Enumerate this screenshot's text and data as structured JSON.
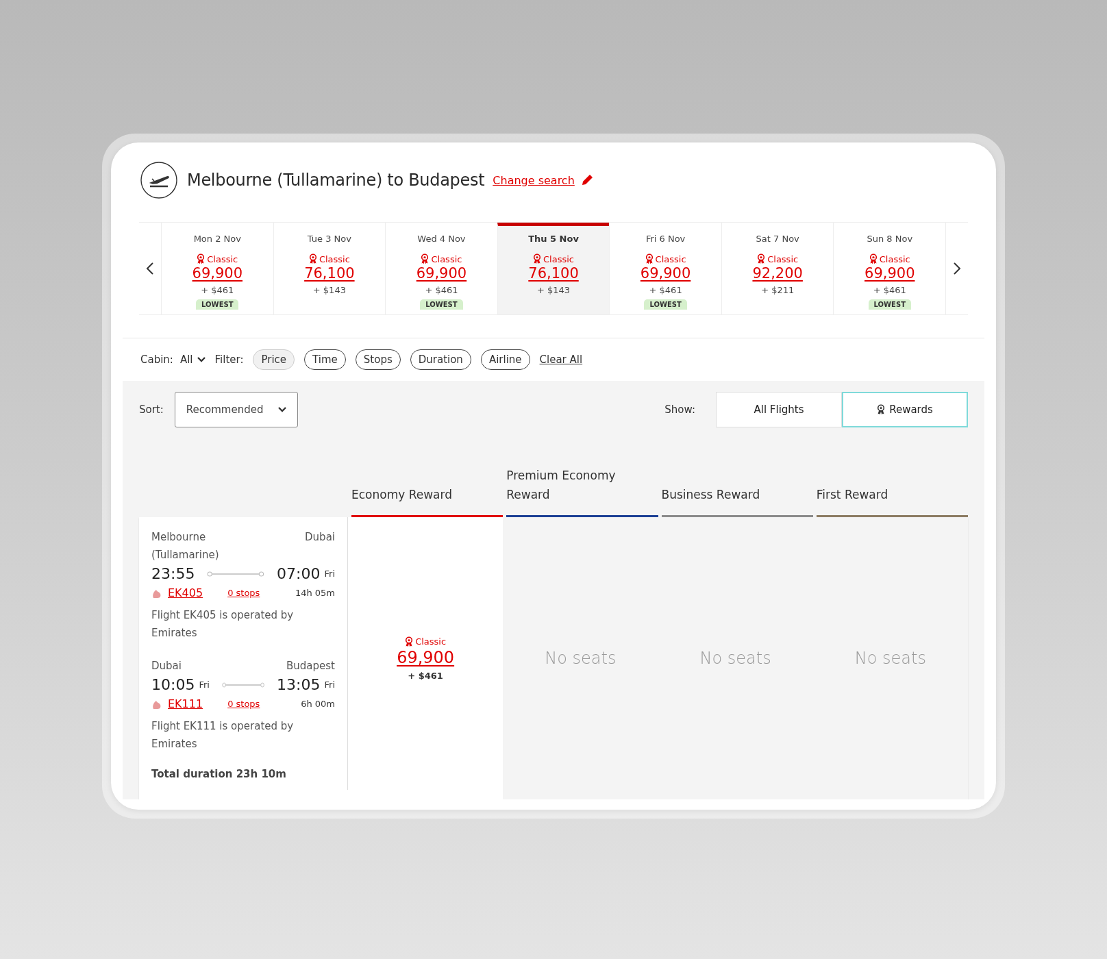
{
  "header": {
    "title": "Melbourne (Tullamarine) to Budapest",
    "change_search": "Change search"
  },
  "dates": [
    {
      "day": "Mon 2 Nov",
      "fare_type": "Classic",
      "points": "69,900",
      "fee": "+ $461",
      "badge": "LOWEST",
      "selected": false
    },
    {
      "day": "Tue 3 Nov",
      "fare_type": "Classic",
      "points": "76,100",
      "fee": "+ $143",
      "selected": false
    },
    {
      "day": "Wed 4 Nov",
      "fare_type": "Classic",
      "points": "69,900",
      "fee": "+ $461",
      "badge": "LOWEST",
      "selected": false
    },
    {
      "day": "Thu 5 Nov",
      "fare_type": "Classic",
      "points": "76,100",
      "fee": "+ $143",
      "selected": true
    },
    {
      "day": "Fri 6 Nov",
      "fare_type": "Classic",
      "points": "69,900",
      "fee": "+ $461",
      "badge": "LOWEST",
      "selected": false
    },
    {
      "day": "Sat 7 Nov",
      "fare_type": "Classic",
      "points": "92,200",
      "fee": "+ $211",
      "selected": false
    },
    {
      "day": "Sun 8 Nov",
      "fare_type": "Classic",
      "points": "69,900",
      "fee": "+ $461",
      "badge": "LOWEST",
      "selected": false
    }
  ],
  "filters": {
    "cabin_label": "Cabin:",
    "cabin_value": "All",
    "filter_label": "Filter:",
    "chips": [
      {
        "label": "Price",
        "selected": true
      },
      {
        "label": "Time",
        "selected": false
      },
      {
        "label": "Stops",
        "selected": false
      },
      {
        "label": "Duration",
        "selected": false
      },
      {
        "label": "Airline",
        "selected": false
      }
    ],
    "clear_all": "Clear All"
  },
  "sort": {
    "label": "Sort:",
    "value": "Recommended"
  },
  "show": {
    "label": "Show:",
    "options": [
      {
        "label": "All Flights",
        "selected": false,
        "kind": "plain"
      },
      {
        "label": "Rewards",
        "selected": true,
        "kind": "reward"
      }
    ]
  },
  "columns": [
    {
      "label": "Economy Reward",
      "color": "#e00000"
    },
    {
      "label": "Premium Economy Reward",
      "color": "#1c3f94"
    },
    {
      "label": "Business Reward",
      "color": "#8a8a8a"
    },
    {
      "label": "First Reward",
      "color": "#8c7b62"
    }
  ],
  "result": {
    "segments": [
      {
        "from": "Melbourne (Tullamarine)",
        "to": "Dubai",
        "depart": "23:55",
        "arrive": "07:00",
        "arrive_day": "Fri",
        "flight": "EK405",
        "stops": "0 stops",
        "duration": "14h 05m",
        "operated": "Flight EK405 is operated by Emirates"
      },
      {
        "from": "Dubai",
        "to": "Budapest",
        "depart": "10:05",
        "depart_day": "Fri",
        "arrive": "13:05",
        "arrive_day": "Fri",
        "flight": "EK111",
        "stops": "0 stops",
        "duration": "6h 00m",
        "operated": "Flight EK111 is operated by Emirates"
      }
    ],
    "total": "Total duration 23h 10m",
    "fares": [
      {
        "kind": "fare",
        "fare_type": "Classic",
        "points": "69,900",
        "fee": "+ $461"
      },
      {
        "kind": "none",
        "text": "No seats"
      },
      {
        "kind": "none",
        "text": "No seats"
      },
      {
        "kind": "none",
        "text": "No seats"
      }
    ]
  }
}
